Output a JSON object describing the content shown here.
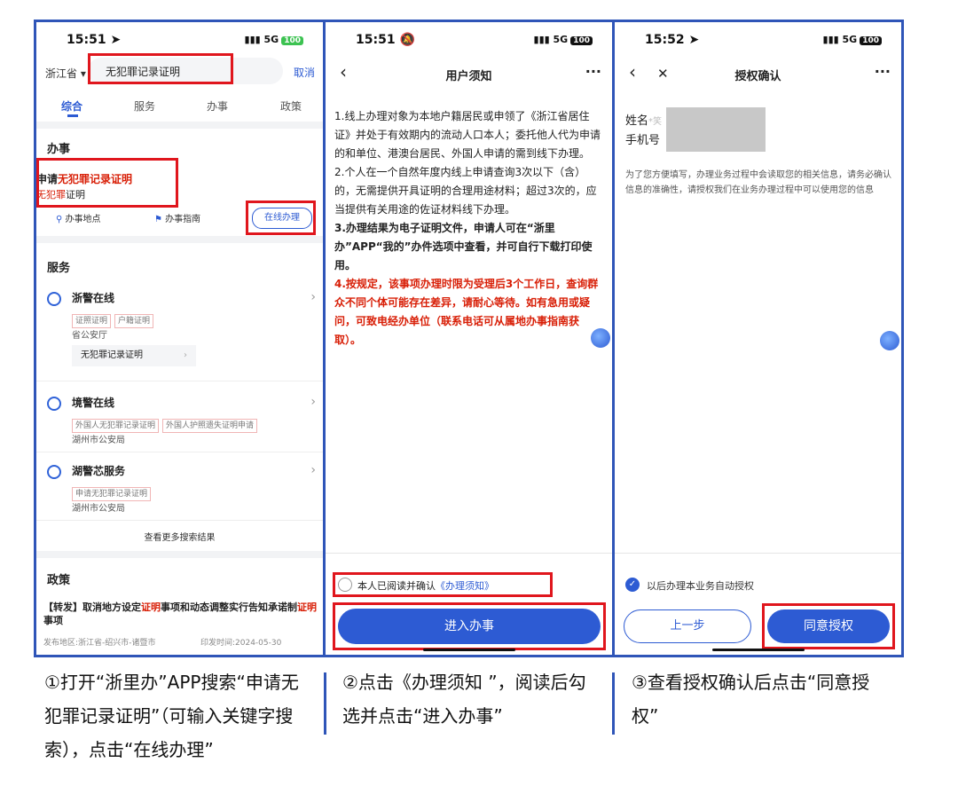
{
  "panel1": {
    "status_time": "15:51",
    "status_signal": "5G",
    "battery": "100",
    "province": "浙江省 ▾",
    "search_value": "无犯罪记录证明",
    "cancel": "取消",
    "tabs": [
      "综合",
      "服务",
      "办事",
      "政策"
    ],
    "section_banshi": "办事",
    "item_title_prefix": "申请",
    "item_title_highlight": "无犯罪记录证明",
    "item_sub_highlight": "无犯罪",
    "item_sub_rest": "证明",
    "location_label": "办事地点",
    "guide_label": "办事指南",
    "online_btn": "在线办理",
    "section_fuwu": "服务",
    "services": [
      {
        "name": "浙警在线",
        "tags": [
          "证照证明",
          "户籍证明"
        ],
        "org": "省公安厅",
        "sub": "无犯罪记录证明",
        "sub_arrow": "›"
      },
      {
        "name": "境警在线",
        "tags": [
          "外国人无犯罪记录证明",
          "外国人护照遗失证明申请"
        ],
        "org": "湖州市公安局"
      },
      {
        "name": "湖警芯服务",
        "tags": [
          "申请无犯罪记录证明"
        ],
        "org": "湖州市公安局"
      }
    ],
    "more_results": "查看更多搜索结果",
    "section_zhengce": "政策",
    "policy_prefix": "【转发】取消地方设定",
    "policy_hl1": "证明",
    "policy_mid": "事项和动态调整实行告知承诺制",
    "policy_hl2": "证明",
    "policy_end": "事项",
    "policy_meta_left": "发布地区:浙江省-绍兴市-诸暨市",
    "policy_meta_right": "印发时间:2024-05-30"
  },
  "panel2": {
    "status_time": "15:51",
    "status_signal": "5G",
    "battery": "100",
    "back": "‹",
    "title": "用户须知",
    "more": "···",
    "p1": "1.线上办理对象为本地户籍居民或申领了《浙江省居住证》并处于有效期内的流动人口本人；委托他人代为申请的和单位、港澳台居民、外国人申请的需到线下办理。",
    "p2": "2.个人在一个自然年度内线上申请查询3次以下（含）的，无需提供开具证明的合理用途材料；超过3次的，应当提供有关用途的佐证材料线下办理。",
    "p3": "3.办理结果为电子证明文件，申请人可在“浙里办”APP“我的”办件选项中查看，并可自行下载打印使用。",
    "p4_prefix": "4.",
    "p4_red": "按规定，该事项办理时限为受理后3个工作日，查询群众不同个体可能存在差异，请耐心等待。如有急用或疑问，可致电经办单位（联系电话可从属地办事指南获取）。",
    "agree_text": "本人已阅读并确认",
    "agree_link": "《办理须知》",
    "enter_btn": "进入办事"
  },
  "panel3": {
    "status_time": "15:52",
    "status_signal": "5G",
    "battery": "100",
    "back": "‹",
    "close": "✕",
    "title": "授权确认",
    "more": "···",
    "name_label": "姓名",
    "name_hint": "*笑",
    "phone_label": "手机号",
    "desc": "为了您方便填写，办理业务过程中会读取您的相关信息，请务必确认信息的准确性，请授权我们在业务办理过程中可以使用您的信息",
    "auto_auth": "以后办理本业务自动授权",
    "prev_btn": "上一步",
    "agree_btn": "同意授权"
  },
  "captions": {
    "c1": "①打开“浙里办”APP搜索“申请无犯罪记录证明”（可输入关键字搜索），点击“在线办理”",
    "c2": "②点击《办理须知 ”，阅读后勾选并点击“进入办事”",
    "c3": "③查看授权确认后点击“同意授权”"
  },
  "colors": {
    "accent": "#2d5bd3",
    "highlight_red": "#e0161d",
    "text_red": "#d81e06",
    "frame_blue": "#2f55b8"
  }
}
